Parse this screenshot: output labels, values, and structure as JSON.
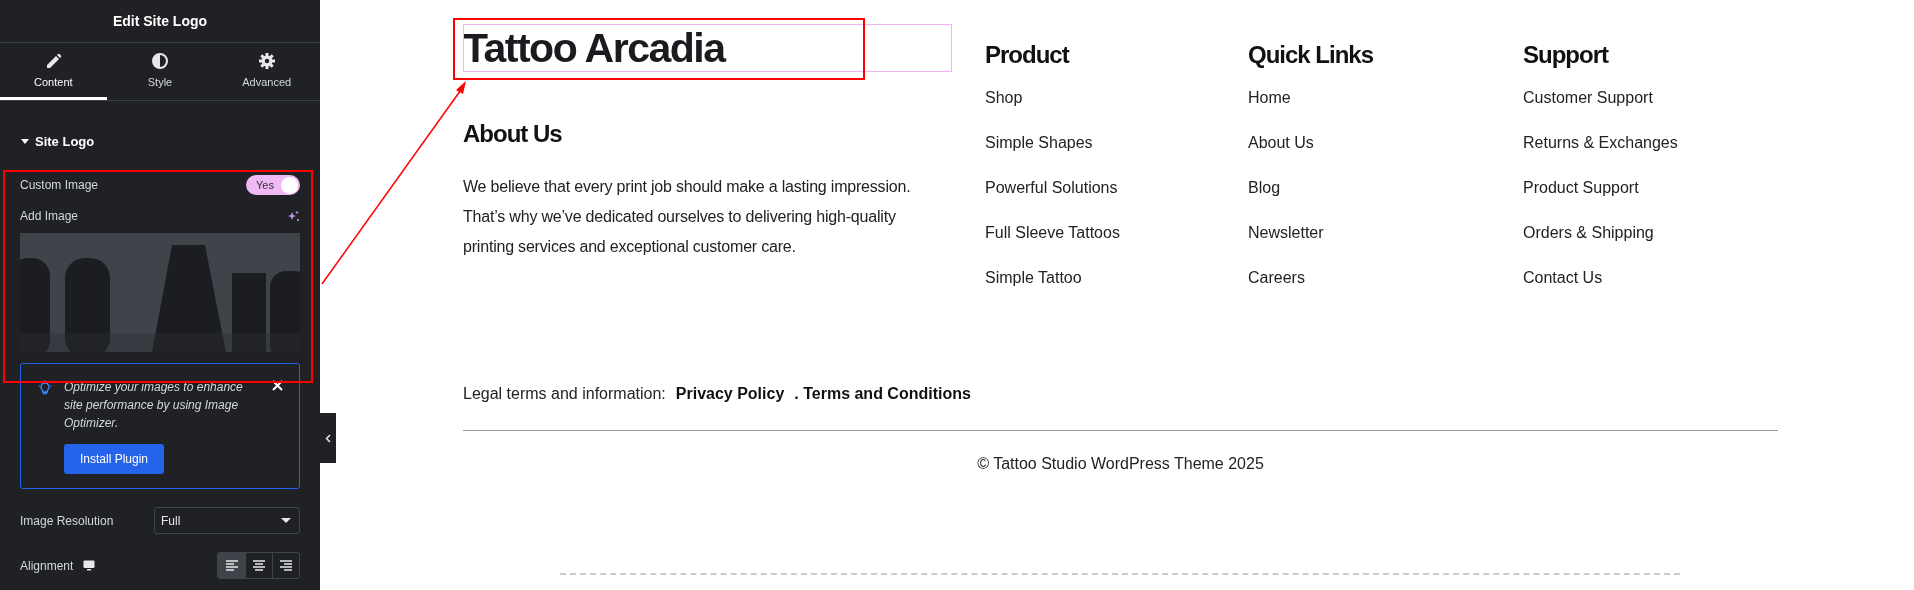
{
  "panel": {
    "title": "Edit Site Logo",
    "tabs": [
      {
        "label": "Content",
        "selected": true
      },
      {
        "label": "Style",
        "selected": false
      },
      {
        "label": "Advanced",
        "selected": false
      }
    ],
    "section": {
      "title": "Site Logo",
      "expanded": true
    },
    "custom_image": {
      "label": "Custom Image",
      "toggle_text": "Yes",
      "on": true
    },
    "add_image": {
      "label": "Add Image"
    },
    "notice": {
      "text": "Optimize your images to enhance site performance by using Image Optimizer.",
      "button": "Install Plugin"
    },
    "image_resolution": {
      "label": "Image Resolution",
      "value": "Full"
    },
    "alignment": {
      "label": "Alignment",
      "options": [
        {
          "selected": true
        },
        {
          "selected": false
        },
        {
          "selected": false
        }
      ]
    }
  },
  "footer": {
    "logo": "Tattoo Arcadia",
    "about": {
      "title": "About Us",
      "text": "We believe that every print job should make a lasting impression. That’s why we’ve dedicated ourselves to delivering high-quality printing services and exceptional customer care."
    },
    "columns": [
      {
        "title": "Product",
        "links": [
          "Shop",
          "Simple Shapes",
          "Powerful Solutions",
          "Full Sleeve Tattoos",
          "Simple Tattoo"
        ]
      },
      {
        "title": "Quick Links",
        "links": [
          "Home",
          "About Us",
          "Blog",
          "Newsletter",
          "Careers"
        ]
      },
      {
        "title": "Support",
        "links": [
          "Customer Support",
          "Returns & Exchanges",
          "Product Support",
          "Orders & Shipping",
          "Contact Us"
        ]
      }
    ],
    "legal": {
      "label": "Legal terms and information:",
      "links": [
        "Privacy Policy",
        ". Terms and Conditions"
      ]
    },
    "copyright": "© Tattoo Studio WordPress Theme 2025"
  }
}
